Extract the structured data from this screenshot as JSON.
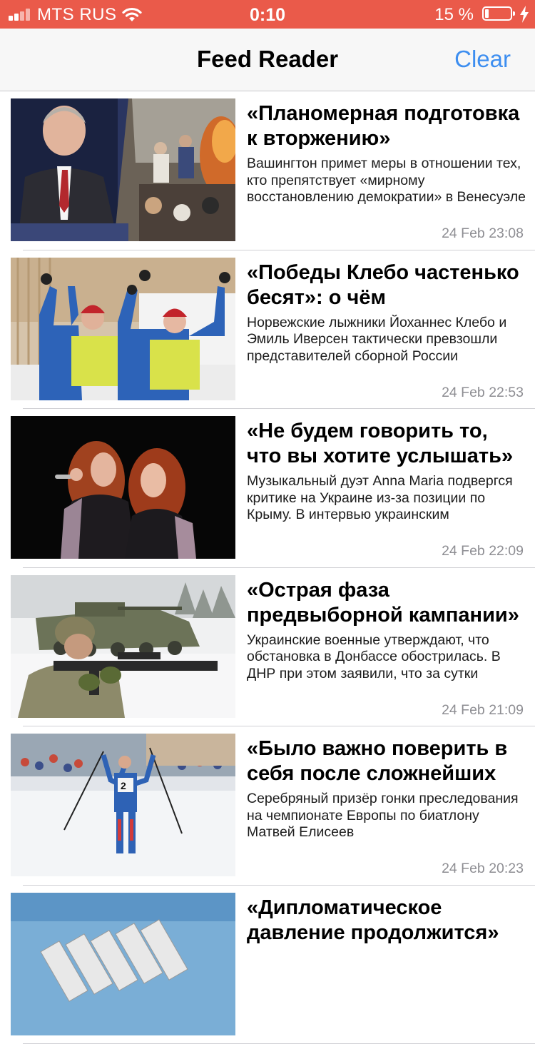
{
  "status_bar": {
    "carrier": "MTS RUS",
    "time": "0:10",
    "battery": "15 %",
    "background": "#ea5a4a"
  },
  "nav": {
    "title": "Feed Reader",
    "clear_label": "Clear",
    "accent": "#3d8ef0"
  },
  "articles": [
    {
      "title": "«Планомерная подготовка к вторжению»",
      "summary": "Вашингтон примет меры в отношении тех, кто препятствует «мирному восстановлению демократии» в Венесуэле",
      "date": "24 Feb 23:08",
      "image": "politician-and-protest-photo"
    },
    {
      "title": "«Победы Клебо частенько бесят»: о чём",
      "summary": "Норвежские лыжники Йоханнес Клебо и Эмиль Иверсен тактически превзошли представителей сборной России",
      "date": "24 Feb 22:53",
      "image": "skiers-celebrating-photo"
    },
    {
      "title": "«Не будем говорить то, что вы хотите услышать»",
      "summary": "Музыкальный дуэт Anna Maria подвергся критике на Украине из-за позиции по Крыму. В интервью украинским",
      "date": "24 Feb 22:09",
      "image": "singers-on-stage-photo"
    },
    {
      "title": "«Острая фаза предвыборной кампании»",
      "summary": "Украинские военные утверждают, что обстановка в Донбассе обострилась. В ДНР при этом заявили, что за сутки",
      "date": "24 Feb 21:09",
      "image": "soldier-and-tank-photo"
    },
    {
      "title": "«Было важно поверить в себя после сложнейших",
      "summary": "Серебряный призёр гонки преследования на чемпионате Европы по биатлону Матвей Елисеев",
      "date": "24 Feb 20:23",
      "image": "biathlete-finish-photo"
    },
    {
      "title": "«Дипломатическое давление продолжится»",
      "summary": "",
      "date": "",
      "image": "missile-launcher-photo"
    }
  ]
}
